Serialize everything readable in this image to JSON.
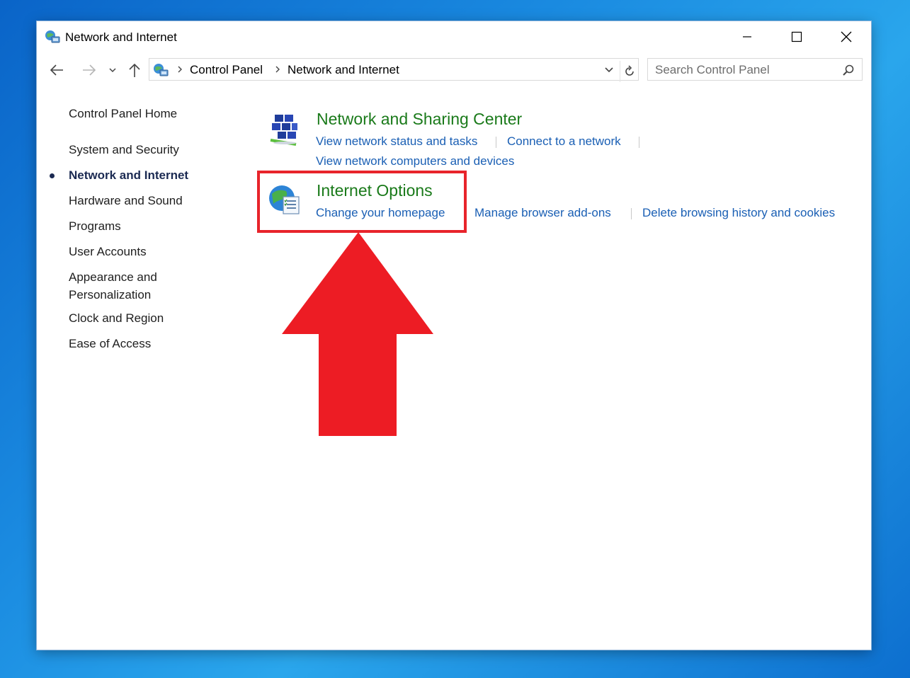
{
  "window": {
    "title": "Network and Internet"
  },
  "address": {
    "crumbs": [
      "Control Panel",
      "Network and Internet"
    ]
  },
  "search": {
    "placeholder": "Search Control Panel"
  },
  "sidebar": {
    "items": [
      {
        "label": "Control Panel Home",
        "active": false
      },
      {
        "label": "System and Security",
        "active": false
      },
      {
        "label": "Network and Internet",
        "active": true
      },
      {
        "label": "Hardware and Sound",
        "active": false
      },
      {
        "label": "Programs",
        "active": false
      },
      {
        "label": "User Accounts",
        "active": false
      },
      {
        "label": "Appearance and",
        "active": false
      },
      {
        "label": "Personalization",
        "active": false
      },
      {
        "label": "Clock and Region",
        "active": false
      },
      {
        "label": "Ease of Access",
        "active": false
      }
    ]
  },
  "categories": [
    {
      "title": "Network and Sharing Center",
      "icon": "network-sharing-icon",
      "links": [
        "View network status and tasks",
        "Connect to a network",
        "View network computers and devices"
      ]
    },
    {
      "title": "Internet Options",
      "icon": "internet-options-icon",
      "links": [
        "Change your homepage",
        "Manage browser add-ons",
        "Delete browsing history and cookies"
      ]
    }
  ],
  "colors": {
    "category_title": "#1a7a1a",
    "link": "#1a5fb4",
    "annotation": "#e8242b"
  }
}
